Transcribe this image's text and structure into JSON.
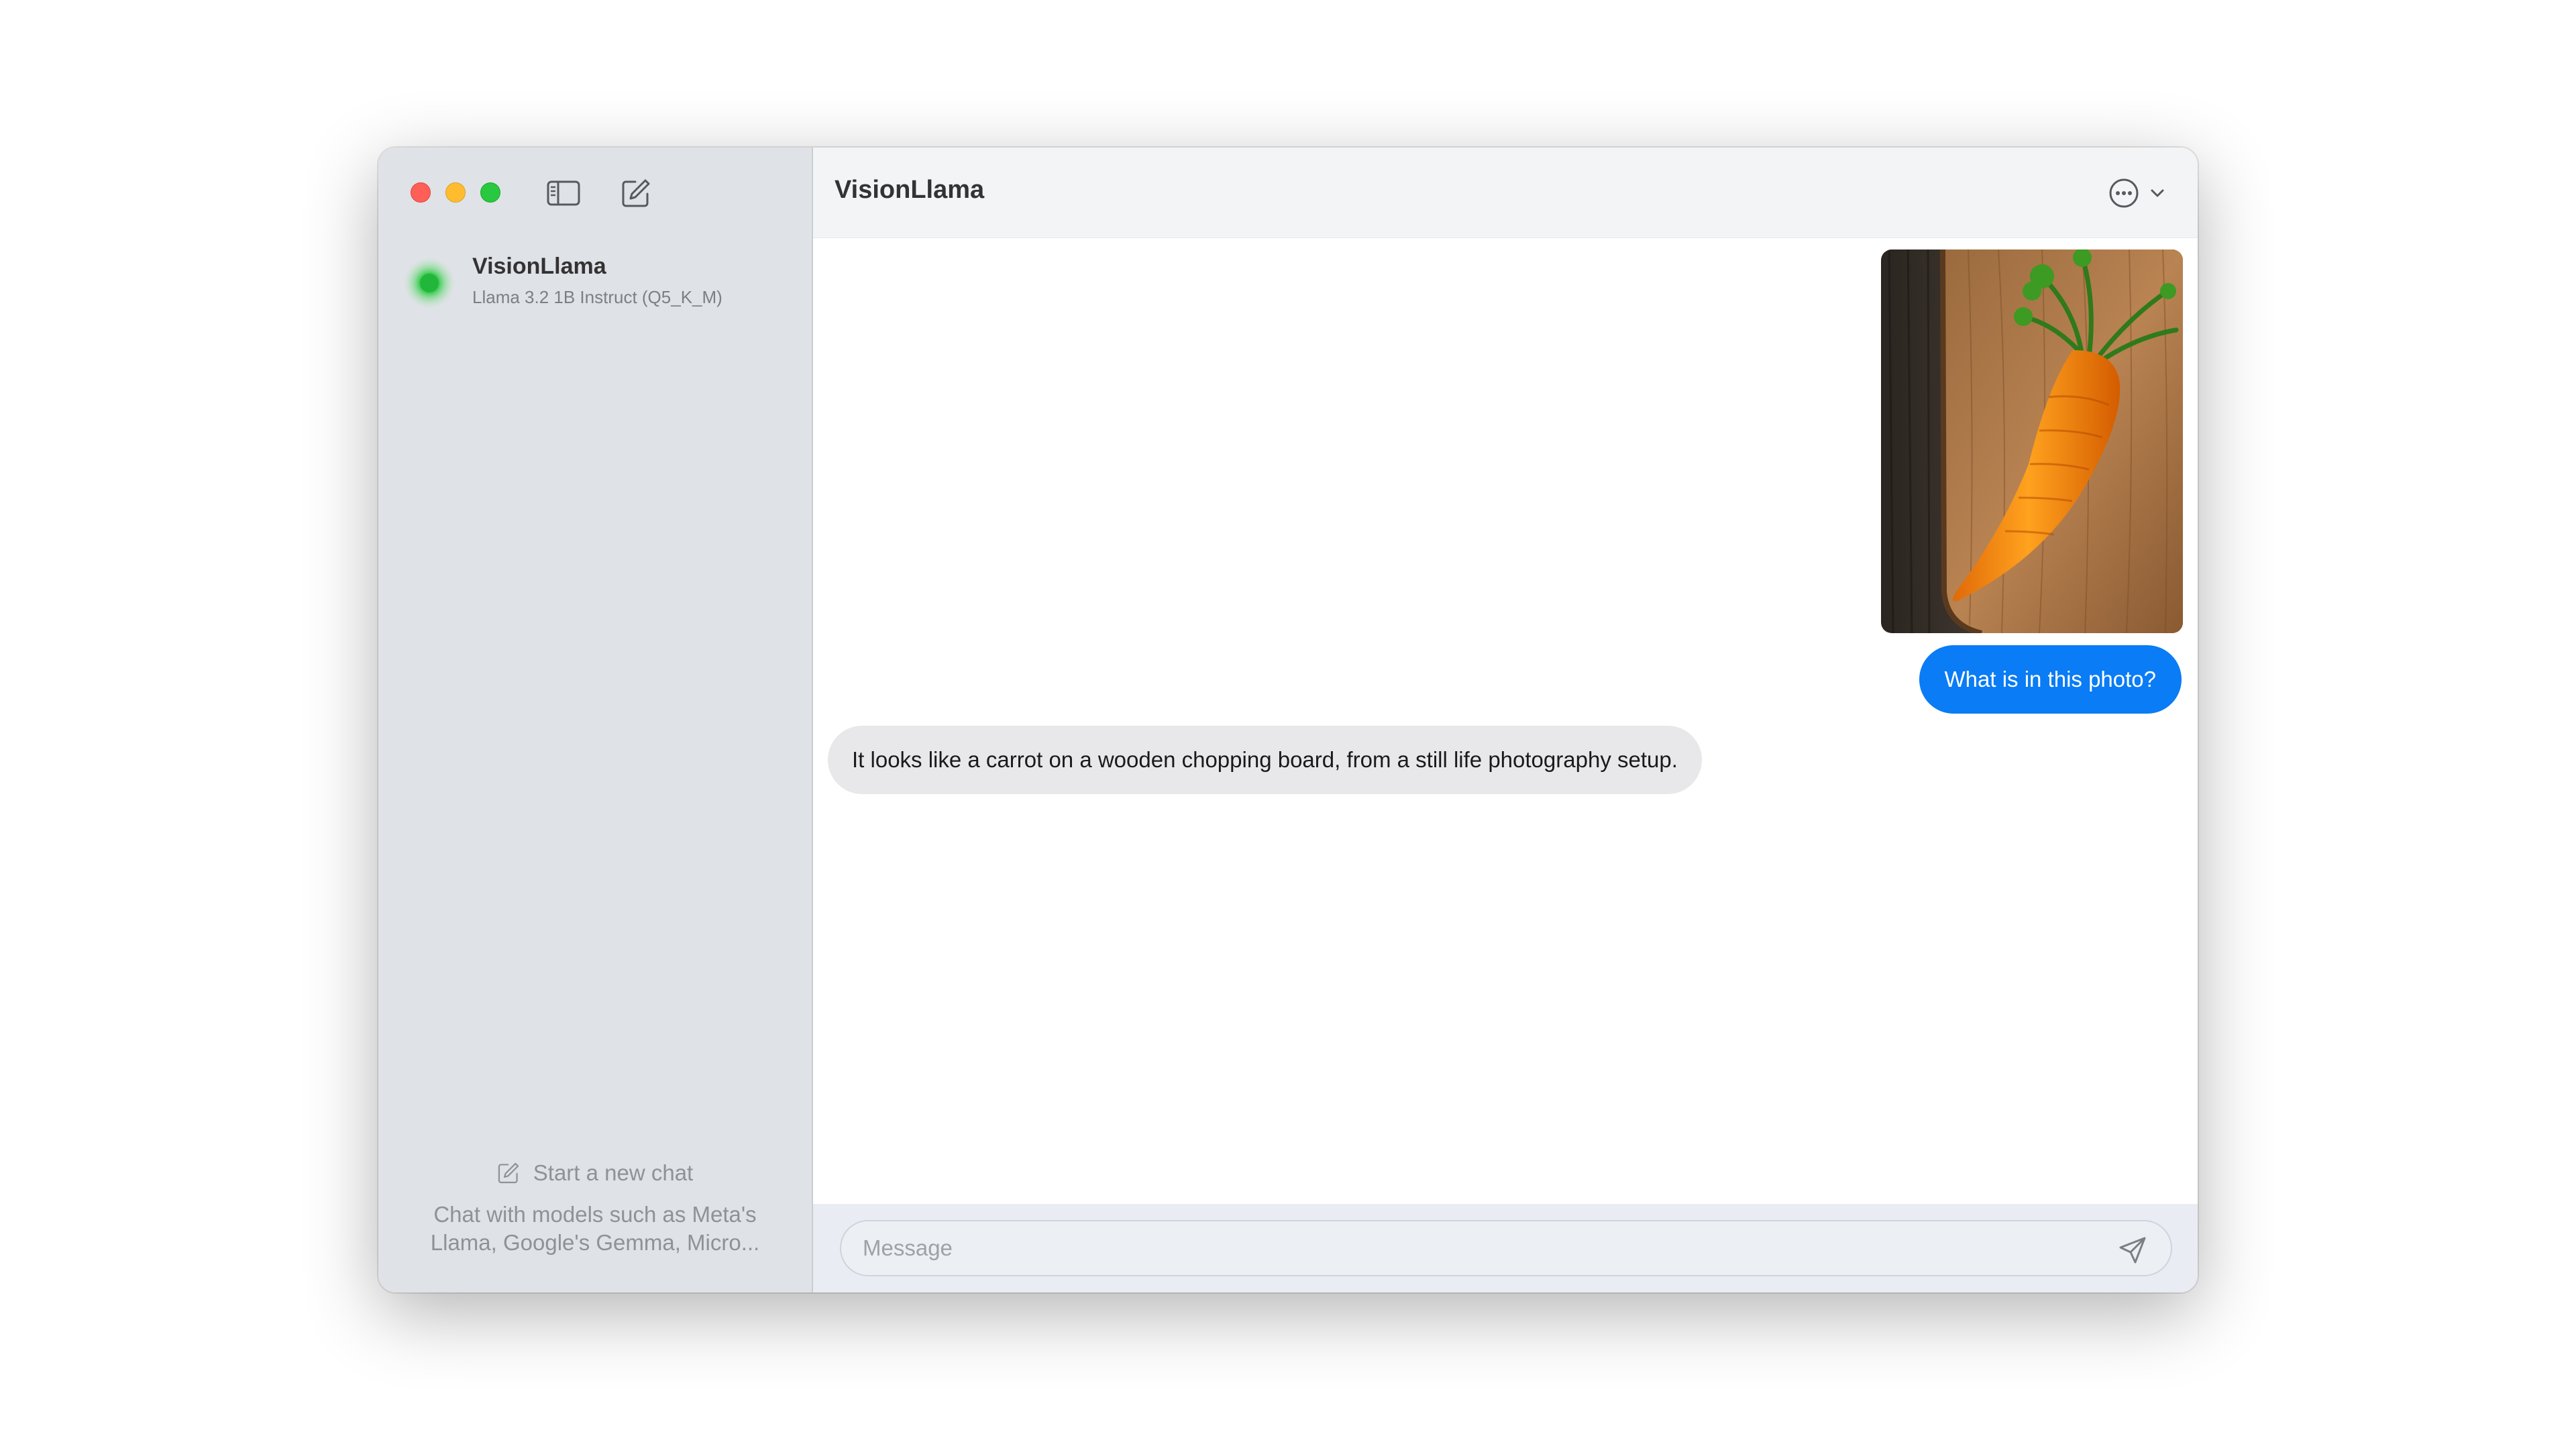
{
  "sidebar": {
    "chat_items": [
      {
        "title": "VisionLlama",
        "subtitle": "Llama 3.2 1B Instruct (Q5_K_M)",
        "status_color": "#28c840"
      }
    ],
    "new_chat_label": "Start a new chat",
    "new_chat_description": "Chat with models such as Meta's Llama, Google's Gemma, Micro..."
  },
  "header": {
    "title": "VisionLlama",
    "icons": [
      "ellipsis-circle-icon",
      "chevron-down-icon"
    ]
  },
  "messages": [
    {
      "role": "user",
      "type": "image",
      "subject": "carrot-on-wooden-board"
    },
    {
      "role": "user",
      "type": "text",
      "text": "What is in this photo?"
    },
    {
      "role": "assistant",
      "type": "text",
      "text": "It looks like a carrot on a wooden chopping board, from a still life photography setup."
    }
  ],
  "composer": {
    "placeholder": "Message",
    "value": ""
  },
  "colors": {
    "accent_blue": "#0a7cf5",
    "close": "#ff5f57",
    "minimize": "#febc2e",
    "maximize": "#28c840"
  }
}
